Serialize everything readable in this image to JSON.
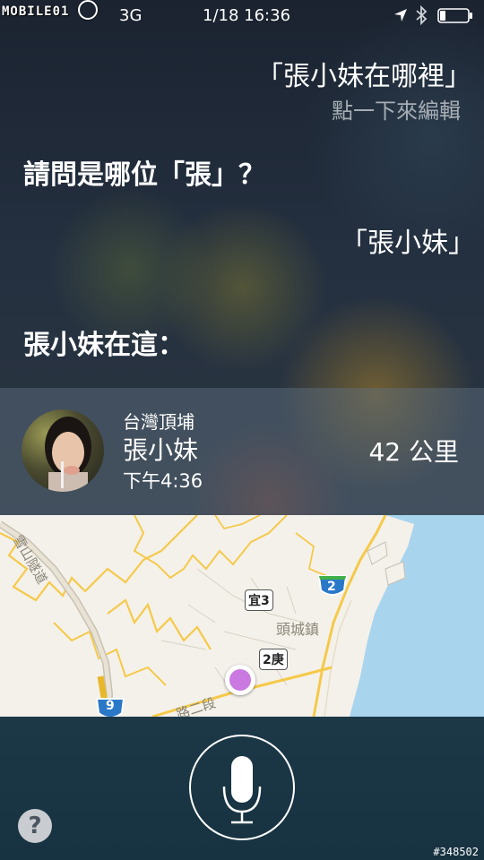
{
  "status_bar": {
    "watermark": "MOBILE01",
    "network": "3G",
    "datetime": "1/18 16:36",
    "icons": [
      "location-arrow-icon",
      "bluetooth-icon",
      "battery-icon"
    ],
    "battery_level": 0.2
  },
  "conversation": {
    "user_query": "「張小妹在哪裡」",
    "edit_hint": "點一下來編輯",
    "siri_question": "請問是哪位「張」？",
    "user_answer": "「張小妹」",
    "siri_result": "張小妹在這："
  },
  "contact": {
    "place": "台灣頂埔",
    "name": "張小妹",
    "time": "下午4:36",
    "distance": "42 公里"
  },
  "map": {
    "road_labels": [
      "宜3",
      "2庚",
      "2",
      "9"
    ],
    "town": "頭城鎮",
    "tunnel": "雪山隧道",
    "street": "路二段",
    "pin_color": "#c979e0",
    "sea_color": "#a9d4ee"
  },
  "controls": {
    "help": "?",
    "mic_icon": "microphone-icon"
  },
  "image_id": "#348502"
}
